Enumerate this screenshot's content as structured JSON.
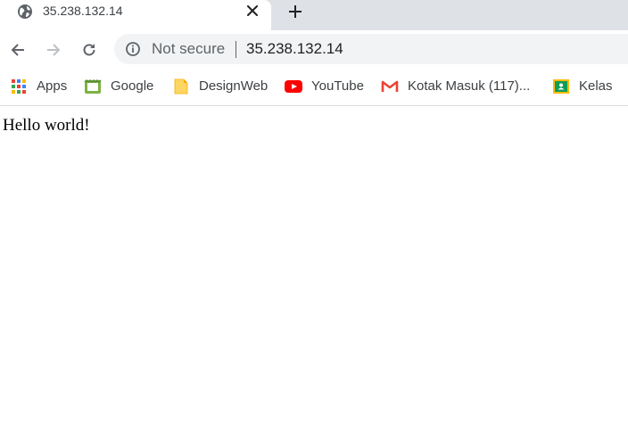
{
  "tab": {
    "title": "35.238.132.14",
    "favicon": "globe-icon"
  },
  "toolbar": {
    "security_label": "Not secure",
    "url": "35.238.132.14"
  },
  "bookmarks": [
    {
      "label": "Apps",
      "icon": "apps-grid-icon"
    },
    {
      "label": "Google",
      "icon": "google-bookmark-icon"
    },
    {
      "label": "DesignWeb",
      "icon": "folder-icon"
    },
    {
      "label": "YouTube",
      "icon": "youtube-icon"
    },
    {
      "label": "Kotak Masuk (117)...",
      "icon": "gmail-icon"
    },
    {
      "label": "Kelas",
      "icon": "classroom-icon"
    }
  ],
  "page": {
    "text": "Hello world!"
  },
  "colors": {
    "tabstrip": "#dee1e6",
    "omnibox": "#f1f3f4",
    "youtube": "#ff0000",
    "gmail": "#ea4335"
  }
}
